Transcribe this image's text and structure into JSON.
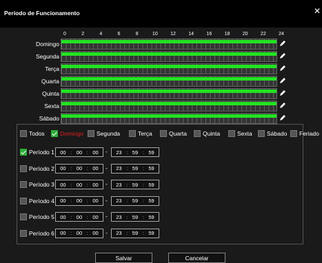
{
  "dialog": {
    "title": "Período de Funcionamento",
    "close_icon": "close-icon"
  },
  "schedule": {
    "hours": [
      "0",
      "2",
      "4",
      "6",
      "8",
      "10",
      "12",
      "14",
      "16",
      "18",
      "20",
      "22",
      "24"
    ],
    "days": [
      {
        "name": "Domingo",
        "coverage": 1.0
      },
      {
        "name": "Segunda",
        "coverage": 1.0
      },
      {
        "name": "Terça",
        "coverage": 1.0
      },
      {
        "name": "Quarta",
        "coverage": 1.0
      },
      {
        "name": "Quinta",
        "coverage": 1.0
      },
      {
        "name": "Sexta",
        "coverage": 1.0
      },
      {
        "name": "Sábado",
        "coverage": 1.0
      }
    ],
    "bar_color": "#22e322",
    "edit_icon": "pencil-icon"
  },
  "day_selector": [
    {
      "label": "Todos",
      "checked": false,
      "active": false
    },
    {
      "label": "Domingo",
      "checked": true,
      "active": true
    },
    {
      "label": "Segunda",
      "checked": false,
      "active": false
    },
    {
      "label": "Terça",
      "checked": false,
      "active": false
    },
    {
      "label": "Quarta",
      "checked": false,
      "active": false
    },
    {
      "label": "Quinta",
      "checked": false,
      "active": false
    },
    {
      "label": "Sexta",
      "checked": false,
      "active": false
    },
    {
      "label": "Sábado",
      "checked": false,
      "active": false
    },
    {
      "label": "Feriado",
      "checked": false,
      "active": false
    }
  ],
  "periods": [
    {
      "label": "Período 1",
      "checked": true,
      "start": [
        "00",
        "00",
        "00"
      ],
      "end": [
        "23",
        "59",
        "59"
      ]
    },
    {
      "label": "Período 2",
      "checked": false,
      "start": [
        "00",
        "00",
        "00"
      ],
      "end": [
        "23",
        "59",
        "59"
      ]
    },
    {
      "label": "Período 3",
      "checked": false,
      "start": [
        "00",
        "00",
        "00"
      ],
      "end": [
        "23",
        "59",
        "59"
      ]
    },
    {
      "label": "Período 4",
      "checked": false,
      "start": [
        "00",
        "00",
        "00"
      ],
      "end": [
        "23",
        "59",
        "59"
      ]
    },
    {
      "label": "Período 5",
      "checked": false,
      "start": [
        "00",
        "00",
        "00"
      ],
      "end": [
        "23",
        "59",
        "59"
      ]
    },
    {
      "label": "Período 6",
      "checked": false,
      "start": [
        "00",
        "00",
        "00"
      ],
      "end": [
        "23",
        "59",
        "59"
      ]
    }
  ],
  "time_separator": ":",
  "range_separator": "-",
  "buttons": {
    "save": "Salvar",
    "cancel": "Cancelar"
  },
  "colors": {
    "accent_green": "#22e322",
    "checked": "#2fae3a",
    "active_label": "#e02020"
  }
}
